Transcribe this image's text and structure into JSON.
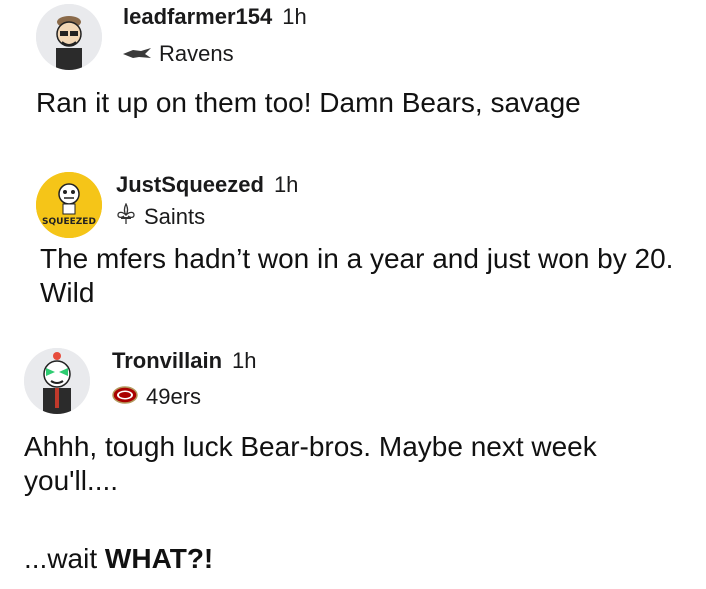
{
  "comments": [
    {
      "username": "leadfarmer154",
      "time": "1h",
      "flair": "Ravens",
      "flair_icon": "raven-icon",
      "text": "Ran it up on them too! Damn Bears, savage"
    },
    {
      "username": "JustSqueezed",
      "time": "1h",
      "flair": "Saints",
      "flair_icon": "fleur-de-lis-icon",
      "avatar_text": "SQUEEZED",
      "text_line1": "The mfers hadn’t won in a year and just won by 20.",
      "text_line2": "Wild"
    },
    {
      "username": "Tronvillain",
      "time": "1h",
      "flair": "49ers",
      "flair_icon": "49ers-logo-icon",
      "text_line1": "Ahhh, tough luck Bear-bros. Maybe next week",
      "text_line2": "you'll....",
      "text_line3_prefix": "...wait ",
      "text_line3_bold": "WHAT?!"
    }
  ],
  "colors": {
    "text": "#1a1a1b",
    "avatar_bg": "#e9eaed",
    "squeezed_yellow": "#f5c518",
    "niners_red": "#aa0000"
  }
}
